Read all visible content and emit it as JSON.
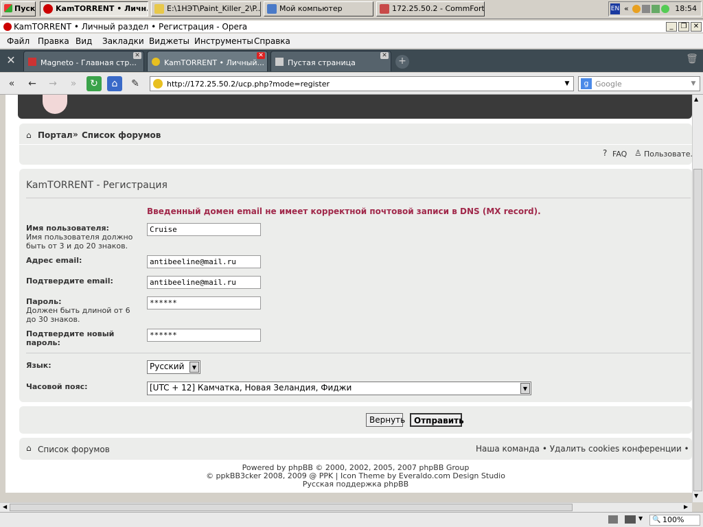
{
  "taskbar": {
    "start_label": "Пуск",
    "buttons": [
      {
        "label": "KamTORRENT • Личн..."
      },
      {
        "label": "E:\\1НЭТ\\Paint_Killer_2\\P..."
      },
      {
        "label": "Мой компьютер"
      },
      {
        "label": "172.25.50.2 - CommFort"
      }
    ],
    "tray_lang": "EN",
    "tray_chevron": "«",
    "clock": "18:54"
  },
  "window": {
    "title": "KamTORRENT • Личный раздел • Регистрация - Opera"
  },
  "menu": [
    "Файл",
    "Правка",
    "Вид",
    "Закладки",
    "Виджеты",
    "Инструменты",
    "Справка"
  ],
  "tabs": [
    {
      "label": "Magneto - Главная стр..."
    },
    {
      "label": "KamTORRENT • Личный..."
    },
    {
      "label": "Пустая страница"
    }
  ],
  "address": {
    "url": "http://172.25.50.2/ucp.php?mode=register"
  },
  "search": {
    "placeholder": "Google"
  },
  "page": {
    "breadcrumb": {
      "portal": "Портал",
      "sep": "»",
      "forums": "Список форумов"
    },
    "toplinks": {
      "faq": "FAQ",
      "users": "Пользовате."
    },
    "heading": "KamTORRENT - Регистрация",
    "error": "Введенный домен email не имеет корректной почтовой записи в DNS (MX record).",
    "fields": {
      "username": {
        "label": "Имя пользователя:",
        "hint": "Имя пользователя должно быть от 3 и до 20 знаков.",
        "value": "Cruise"
      },
      "email": {
        "label": "Адрес email:",
        "value": "antibeeline@mail.ru"
      },
      "email_confirm": {
        "label": "Подтвердите email:",
        "value": "antibeeline@mail.ru"
      },
      "password": {
        "label": "Пароль:",
        "hint": "Должен быть длиной от 6 до 30 знаков.",
        "value": "******"
      },
      "password_confirm": {
        "label": "Подтвердите новый пароль:",
        "value": "******"
      },
      "language": {
        "label": "Язык:",
        "value": "Русский"
      },
      "timezone": {
        "label": "Часовой пояс:",
        "value": "[UTC + 12] Камчатка, Новая Зеландия, Фиджи"
      }
    },
    "buttons": {
      "reset": "Вернуть",
      "submit": "Отправить"
    },
    "footer_nav": {
      "forums": "Список форумов",
      "right": "Наша команда • Удалить cookies конференции • Час"
    },
    "credits": [
      "Powered by phpBB © 2000, 2002, 2005, 2007 phpBB Group",
      "© ppkBB3cker 2008, 2009 @ PPK | Icon Theme by Everaldo.com Design Studio",
      "Русская поддержка phpBB"
    ]
  },
  "status": {
    "zoom": "100%"
  }
}
